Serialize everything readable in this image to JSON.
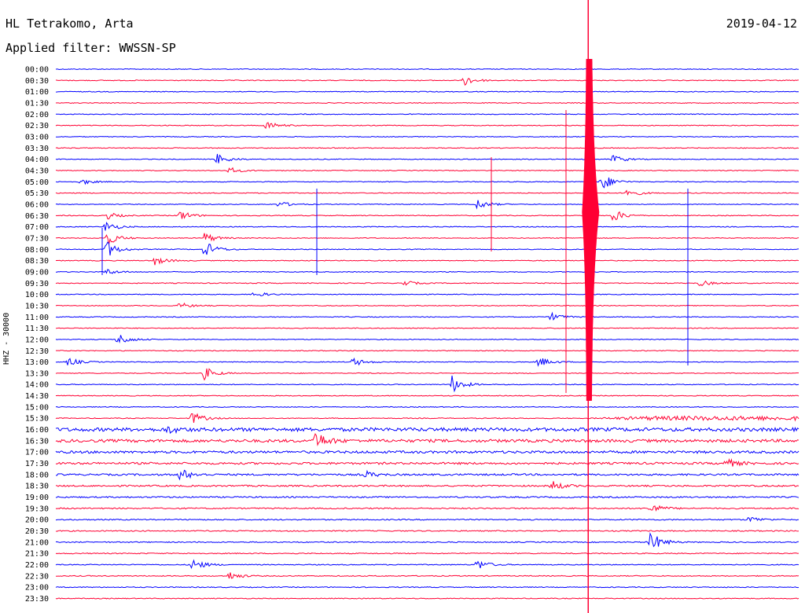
{
  "header": {
    "station": "HL Tetrakomo, Arta",
    "filter": "Applied filter: WWSSN-SP",
    "date": "2019-04-12"
  },
  "chart_data": {
    "type": "line",
    "title": "HL Tetrakomo, Arta",
    "subtitle": "Applied filter: WWSSN-SP",
    "date": "2019-04-12",
    "ylabel": "HHZ - 30000",
    "tick_labels": [
      "00:00",
      "00:30",
      "01:00",
      "01:30",
      "02:00",
      "02:30",
      "03:00",
      "03:30",
      "04:00",
      "04:30",
      "05:00",
      "05:30",
      "06:00",
      "06:30",
      "07:00",
      "07:30",
      "08:00",
      "08:30",
      "09:00",
      "09:30",
      "10:00",
      "10:30",
      "11:00",
      "11:30",
      "12:00",
      "12:30",
      "13:00",
      "13:30",
      "14:00",
      "14:30",
      "15:00",
      "15:30",
      "16:00",
      "16:30",
      "17:00",
      "17:30",
      "18:00",
      "18:30",
      "19:00",
      "19:30",
      "20:00",
      "20:30",
      "21:00",
      "21:30",
      "22:00",
      "22:30",
      "23:00",
      "23:30"
    ],
    "trace_colors": [
      "#0000ff",
      "#ff0033"
    ],
    "grid": false,
    "trace_minutes": 30,
    "events": [
      [
        1,
        16.5,
        0.5
      ],
      [
        5,
        8.5,
        0.4
      ],
      [
        8,
        6.5,
        0.5
      ],
      [
        8,
        22.5,
        0.4
      ],
      [
        9,
        7,
        0.3
      ],
      [
        10,
        22,
        0.9
      ],
      [
        10,
        1,
        0.3
      ],
      [
        11,
        23,
        0.5
      ],
      [
        12,
        17,
        0.5
      ],
      [
        12,
        9,
        0.3
      ],
      [
        13,
        22.5,
        0.6
      ],
      [
        13,
        2,
        0.4
      ],
      [
        13,
        5,
        0.5
      ],
      [
        14,
        2,
        0.5
      ],
      [
        15,
        2,
        0.8
      ],
      [
        15,
        6,
        0.5
      ],
      [
        16,
        2,
        0.9
      ],
      [
        16,
        6,
        0.8
      ],
      [
        17,
        4,
        0.4
      ],
      [
        18,
        2,
        0.3
      ],
      [
        19,
        14,
        0.3
      ],
      [
        19,
        26,
        0.3
      ],
      [
        20,
        8,
        0.3
      ],
      [
        21,
        5,
        0.3
      ],
      [
        22,
        20,
        0.4
      ],
      [
        24,
        2.5,
        0.6
      ],
      [
        26,
        0.5,
        0.4
      ],
      [
        26,
        12,
        0.4
      ],
      [
        26,
        19.5,
        0.5
      ],
      [
        27,
        6,
        0.6
      ],
      [
        28,
        16,
        0.8
      ],
      [
        31,
        5.5,
        0.6
      ],
      [
        32,
        4.5,
        0.3
      ],
      [
        33,
        10.5,
        0.8
      ],
      [
        35,
        27,
        0.5
      ],
      [
        36,
        5,
        0.6
      ],
      [
        36,
        12.5,
        0.3
      ],
      [
        37,
        20,
        0.5
      ],
      [
        39,
        24,
        0.5
      ],
      [
        40,
        28,
        0.3
      ],
      [
        42,
        24,
        1.0
      ],
      [
        44,
        5.5,
        0.6
      ],
      [
        44,
        17,
        0.5
      ],
      [
        45,
        7,
        0.4
      ]
    ],
    "big_event": {
      "start": [
        31,
        21.5
      ],
      "peak_amplitude": 1.0
    }
  },
  "icons": []
}
